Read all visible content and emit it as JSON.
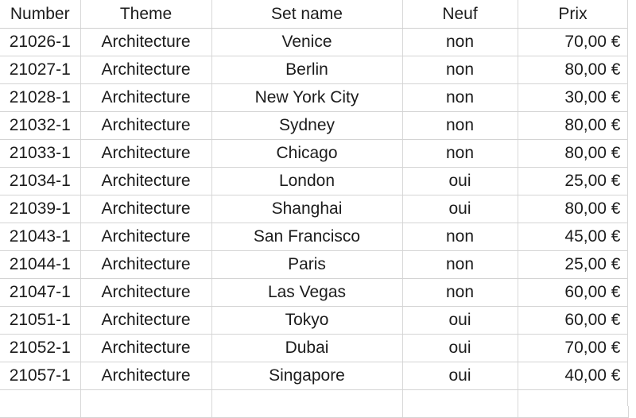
{
  "table": {
    "columns": [
      {
        "key": "number",
        "label": "Number",
        "align": "center"
      },
      {
        "key": "theme",
        "label": "Theme",
        "align": "center"
      },
      {
        "key": "setname",
        "label": "Set name",
        "align": "center"
      },
      {
        "key": "neuf",
        "label": "Neuf",
        "align": "center"
      },
      {
        "key": "prix",
        "label": "Prix",
        "align": "right"
      }
    ],
    "rows": [
      {
        "number": "21026-1",
        "theme": "Architecture",
        "setname": "Venice",
        "neuf": "non",
        "prix": "70,00 €"
      },
      {
        "number": "21027-1",
        "theme": "Architecture",
        "setname": "Berlin",
        "neuf": "non",
        "prix": "80,00 €"
      },
      {
        "number": "21028-1",
        "theme": "Architecture",
        "setname": "New York City",
        "neuf": "non",
        "prix": "30,00 €"
      },
      {
        "number": "21032-1",
        "theme": "Architecture",
        "setname": "Sydney",
        "neuf": "non",
        "prix": "80,00 €"
      },
      {
        "number": "21033-1",
        "theme": "Architecture",
        "setname": "Chicago",
        "neuf": "non",
        "prix": "80,00 €"
      },
      {
        "number": "21034-1",
        "theme": "Architecture",
        "setname": "London",
        "neuf": "oui",
        "prix": "25,00 €"
      },
      {
        "number": "21039-1",
        "theme": "Architecture",
        "setname": "Shanghai",
        "neuf": "oui",
        "prix": "80,00 €"
      },
      {
        "number": "21043-1",
        "theme": "Architecture",
        "setname": "San Francisco",
        "neuf": "non",
        "prix": "45,00 €"
      },
      {
        "number": "21044-1",
        "theme": "Architecture",
        "setname": "Paris",
        "neuf": "non",
        "prix": "25,00 €"
      },
      {
        "number": "21047-1",
        "theme": "Architecture",
        "setname": "Las Vegas",
        "neuf": "non",
        "prix": "60,00 €"
      },
      {
        "number": "21051-1",
        "theme": "Architecture",
        "setname": "Tokyo",
        "neuf": "oui",
        "prix": "60,00 €"
      },
      {
        "number": "21052-1",
        "theme": "Architecture",
        "setname": "Dubai",
        "neuf": "oui",
        "prix": "70,00 €"
      },
      {
        "number": "21057-1",
        "theme": "Architecture",
        "setname": "Singapore",
        "neuf": "oui",
        "prix": "40,00 €"
      }
    ],
    "trailing_empty_row": {
      "number": "",
      "theme": "",
      "setname": "",
      "neuf": "",
      "prix": ""
    }
  },
  "style": {
    "grid_line_color": "#d4d4d4",
    "text_color": "#1c1c1c",
    "background_color": "#ffffff"
  }
}
